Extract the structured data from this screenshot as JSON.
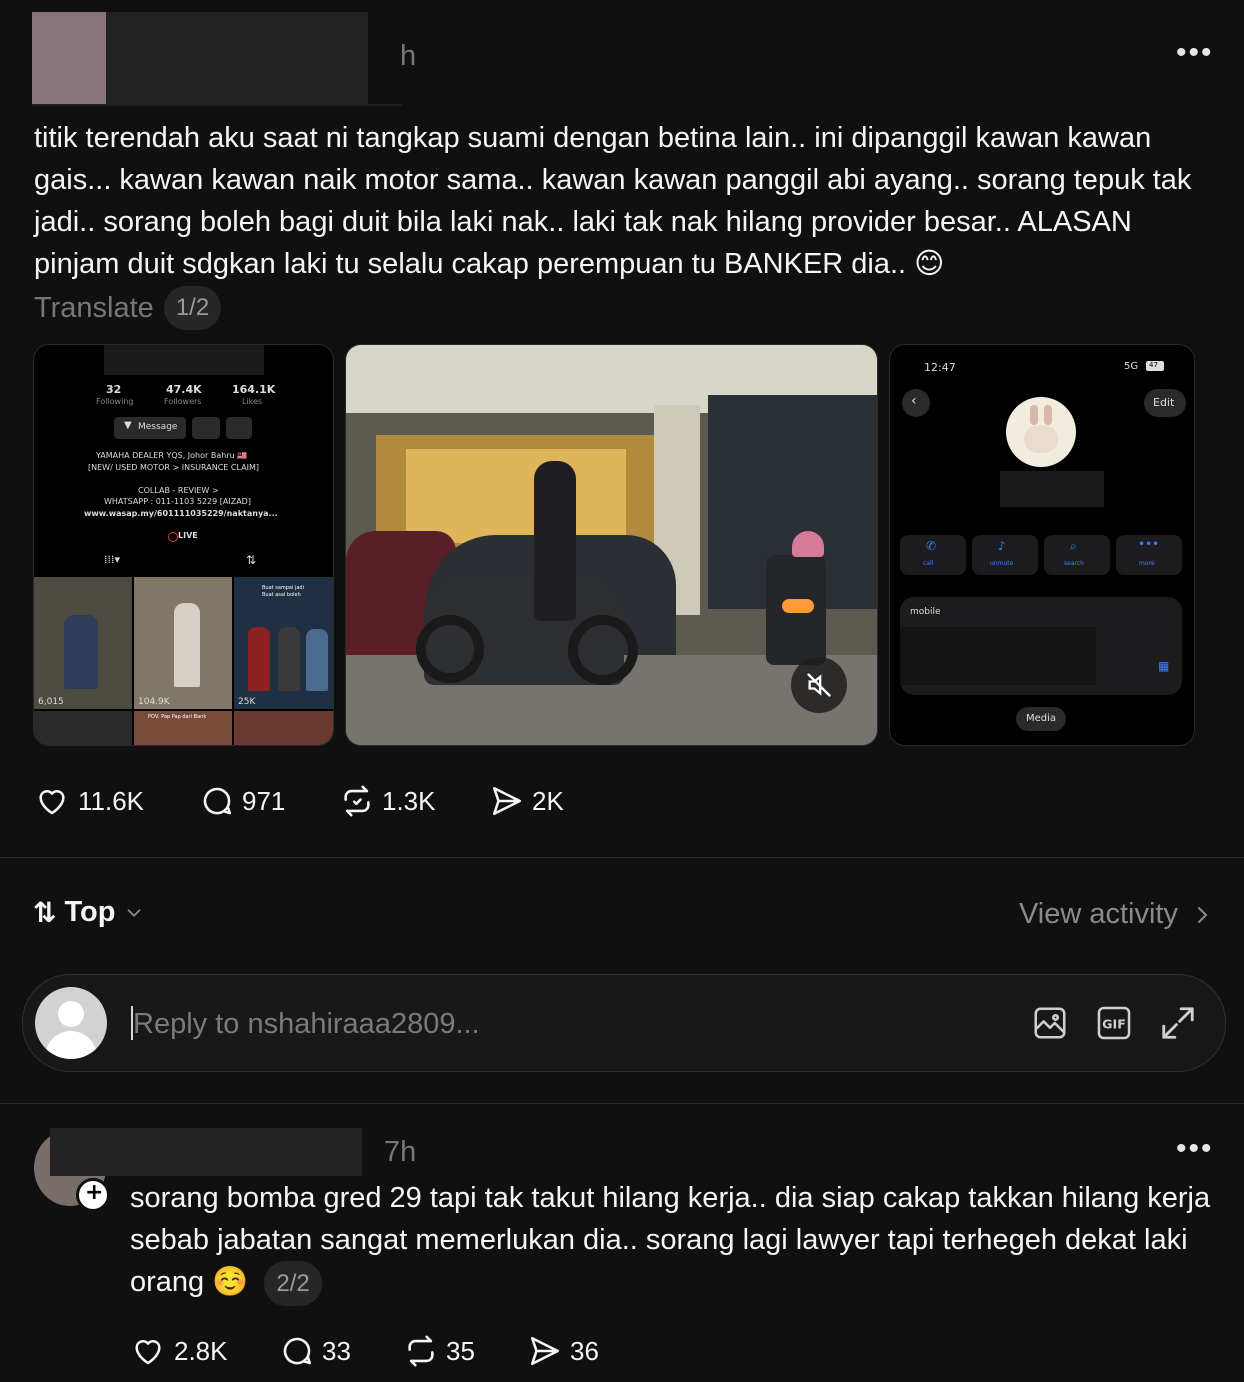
{
  "post": {
    "time": "h",
    "text": "titik terendah aku saat ni tangkap suami dengan betina lain.. ini dipanggil kawan kawan gais... kawan kawan naik motor sama.. kawan kawan panggil abi ayang.. sorang tepuk tak jadi.. sorang boleh bagi duit bila laki nak.. laki tak nak hilang provider besar.. ALASAN pinjam duit sdgkan laki tu selalu cakap perempuan tu BANKER dia.. 😊",
    "translate": "Translate",
    "page": "1/2",
    "media": {
      "profile": {
        "following_count": "32",
        "following_label": "Following",
        "followers_count": "47.4K",
        "followers_label": "Followers",
        "likes_count": "164.1K",
        "likes_label": "Likes",
        "message_label": "Message",
        "bio_line1": "YAMAHA DEALER YQS, Johor Bahru 🇲🇾",
        "bio_line2": "[NEW/ USED MOTOR > INSURANCE CLAIM]",
        "bio_line3": "COLLAB - REVIEW >",
        "bio_line4": "WHATSAPP : 011-1103 5229 [AIZAD]",
        "bio_link": "www.wasap.my/601111035229/naktanya...",
        "live_label": "LIVE",
        "grid_views": [
          "6,015",
          "104.9K",
          "25K"
        ],
        "grid_caption_1": "Buat sampai jadi",
        "grid_caption_2": "Buat asal boleh",
        "grid_caption_3": "POV: Pap Pap dari Bank"
      },
      "contact": {
        "status_time": "12:47",
        "status_network": "5G",
        "battery": "47",
        "edit_label": "Edit",
        "call_label": "call",
        "unmute_label": "unmute",
        "search_label": "search",
        "more_label": "more",
        "mobile_label": "mobile",
        "media_button": "Media"
      }
    },
    "actions": {
      "likes": "11.6K",
      "comments": "971",
      "reposts": "1.3K",
      "shares": "2K"
    }
  },
  "sort": {
    "label": "Top"
  },
  "view_activity": "View activity",
  "reply": {
    "placeholder": "Reply to nshahiraaa2809..."
  },
  "comment": {
    "time": "7h",
    "text": "sorang bomba gred 29 tapi tak takut hilang kerja.. dia siap cakap takkan hilang kerja sebab jabatan sangat memerlukan dia.. sorang lagi lawyer tapi terhegeh dekat laki orang ☺️",
    "page": "2/2",
    "actions": {
      "likes": "2.8K",
      "comments": "33",
      "reposts": "35",
      "shares": "36"
    }
  },
  "icons": {
    "more": "more-horizontal-icon",
    "like": "heart-icon",
    "comment": "comment-bubble-icon",
    "repost": "repost-icon",
    "share": "send-icon",
    "image": "image-icon",
    "gif": "gif-icon",
    "expand": "expand-icon"
  },
  "colors": {
    "background": "#101010",
    "text": "#f3f5f7",
    "muted": "#777777"
  }
}
